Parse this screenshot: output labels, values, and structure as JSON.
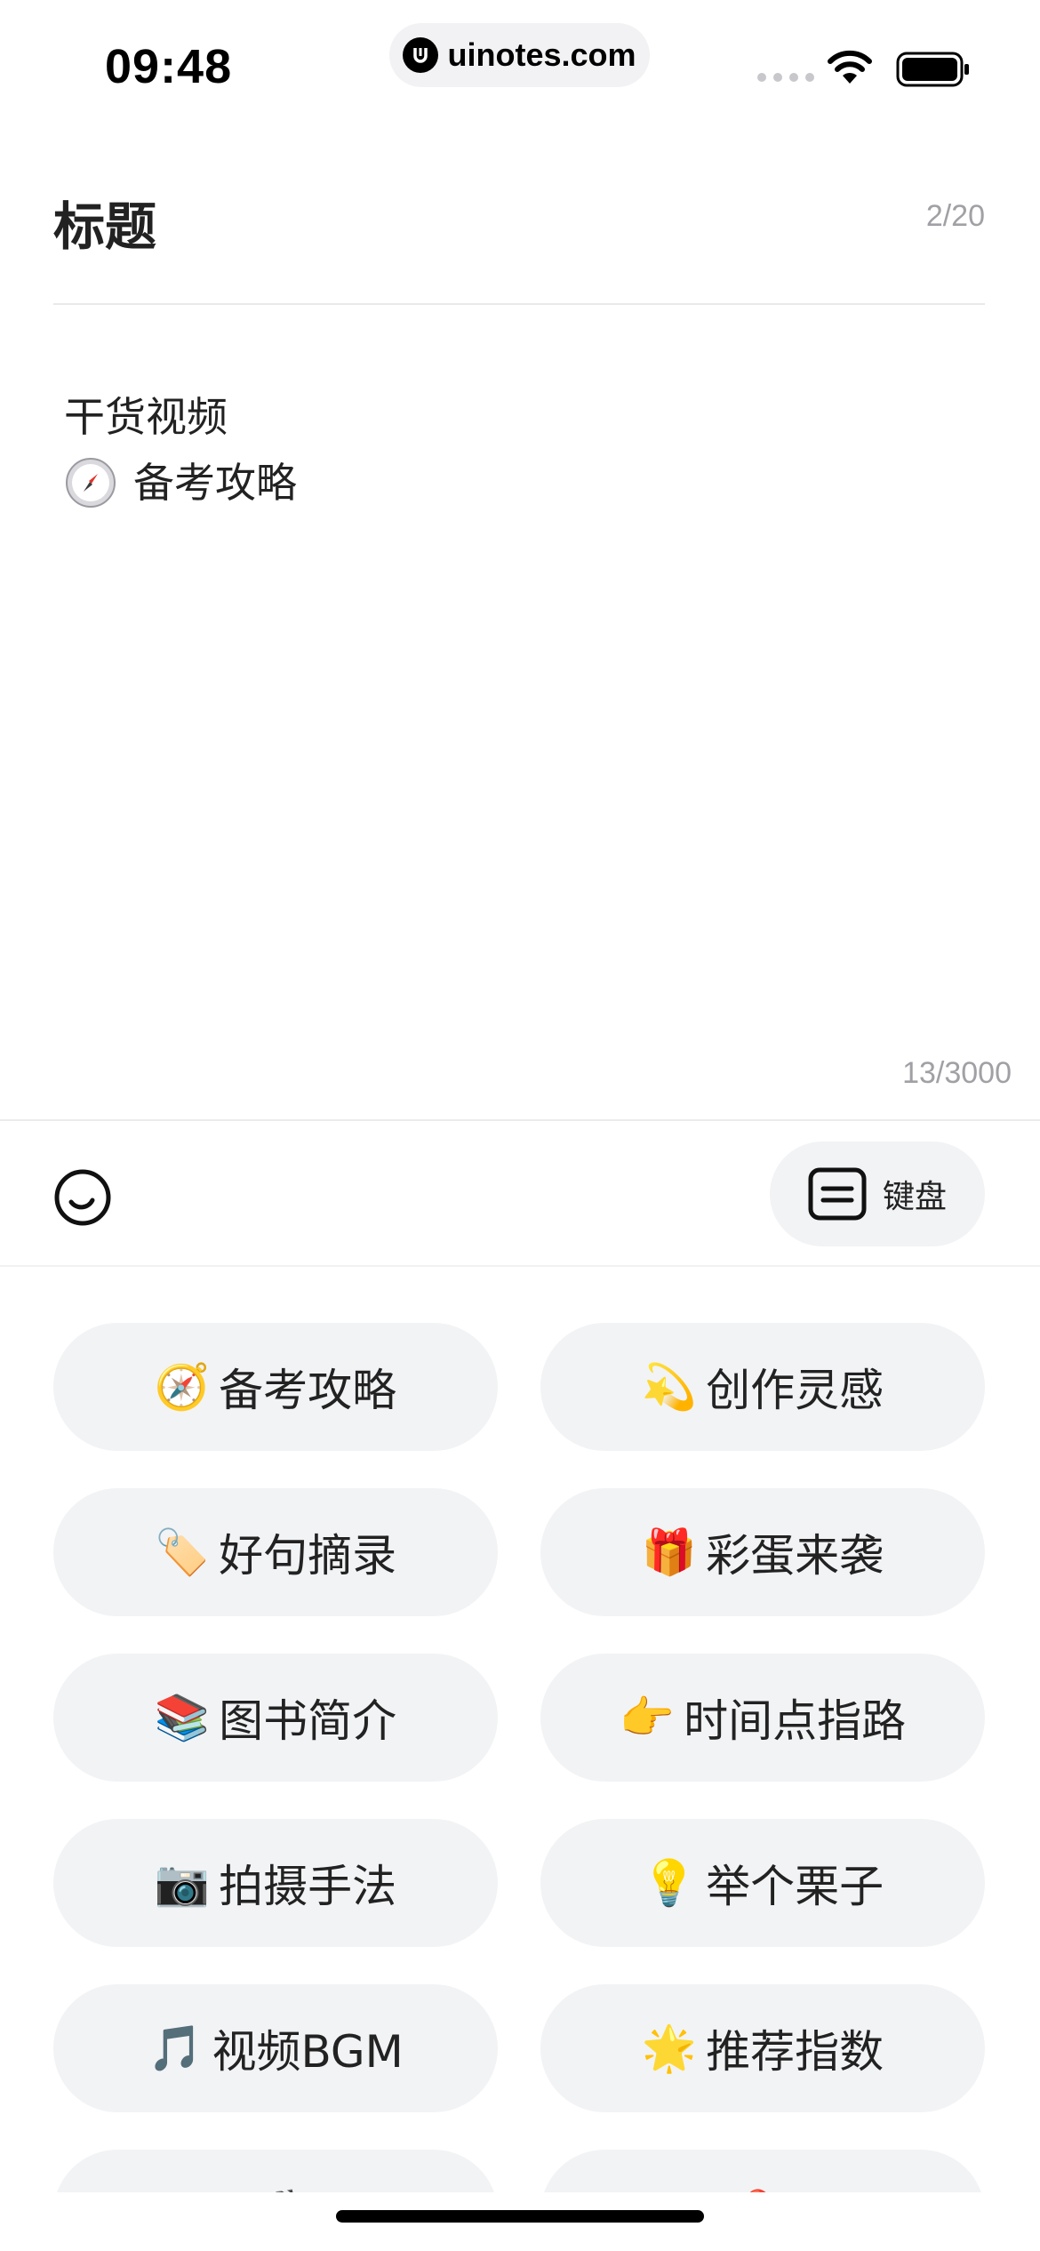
{
  "status_bar": {
    "time": "09:48",
    "url": "uinotes.com"
  },
  "title": {
    "label": "标题",
    "count": "2/20"
  },
  "body": {
    "lines": [
      {
        "icon": "",
        "text": "干货视频"
      },
      {
        "icon": "compass-icon",
        "text": "备考攻略"
      }
    ],
    "count": "13/3000"
  },
  "toolbar": {
    "emoji_icon": "smiley-icon",
    "keyboard_label": "键盘",
    "keyboard_icon": "keyboard-icon"
  },
  "chips": [
    {
      "icon": "🧭",
      "icon_name": "compass-icon",
      "label": "备考攻略"
    },
    {
      "icon": "💫",
      "icon_name": "dizzy-star-icon",
      "label": "创作灵感"
    },
    {
      "icon": "🏷️",
      "icon_name": "label-tag-icon",
      "label": "好句摘录"
    },
    {
      "icon": "🎁",
      "icon_name": "gift-icon",
      "label": "彩蛋来袭"
    },
    {
      "icon": "📚",
      "icon_name": "books-icon",
      "label": "图书简介"
    },
    {
      "icon": "👉",
      "icon_name": "pointing-hand-icon",
      "label": "时间点指路"
    },
    {
      "icon": "📷",
      "icon_name": "camera-icon",
      "label": "拍摄手法"
    },
    {
      "icon": "💡",
      "icon_name": "light-bulb-icon",
      "label": "举个栗子"
    },
    {
      "icon": "🎵",
      "icon_name": "music-note-icon",
      "label": "视频BGM"
    },
    {
      "icon": "🌟",
      "icon_name": "glowing-star-icon",
      "label": "推荐指数"
    },
    {
      "icon": "🎬",
      "icon_name": "clapper-icon",
      "label": ""
    },
    {
      "icon": "📍",
      "icon_name": "pin-icon",
      "label": ""
    }
  ],
  "colors": {
    "chip_bg": "#f2f3f5",
    "muted_text": "#a0a0a5",
    "text": "#222222"
  }
}
